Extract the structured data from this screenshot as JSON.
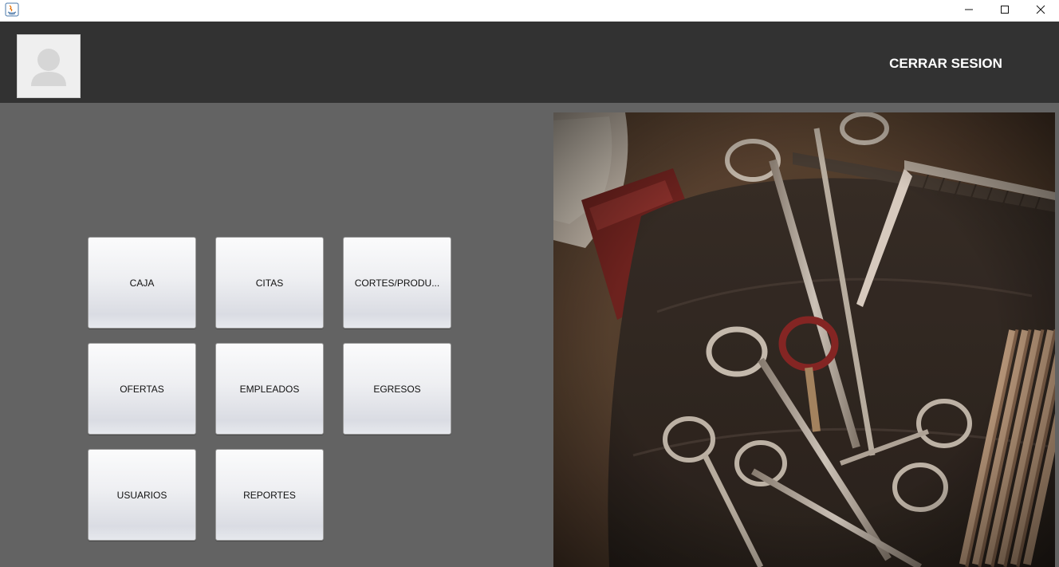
{
  "window": {
    "controls": [
      "minimize",
      "maximize",
      "close"
    ]
  },
  "header": {
    "logout_label": "CERRAR SESION"
  },
  "menu": {
    "caja": "CAJA",
    "citas": "CITAS",
    "cortes": "CORTES/PRODU...",
    "ofertas": "OFERTAS",
    "empleados": "EMPLEADOS",
    "egresos": "EGRESOS",
    "usuarios": "USUARIOS",
    "reportes": "REPORTES"
  },
  "colors": {
    "header_bg": "#323232",
    "body_bg": "#636363",
    "titlebar_bg": "#ffffff"
  },
  "icons": {
    "app": "java-icon",
    "avatar": "user-silhouette-icon"
  }
}
